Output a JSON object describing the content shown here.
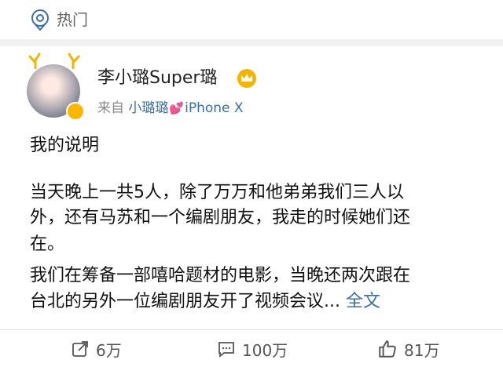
{
  "topbar": {
    "label": "热门"
  },
  "author": {
    "name": "李小璐Super璐",
    "source_prefix": "来自",
    "source_name": "小璐璐",
    "source_heart": "💕",
    "source_device": "iPhone X"
  },
  "post": {
    "line1": "我的说明",
    "line2": "当天晚上一共5人，除了万万和他弟弟我们三人以",
    "line3": "外，还有马苏和一个编剧朋友，我走的时候她们还",
    "line4": "在。",
    "line5": "我们在筹备一部嘻哈题材的电影，当晚还两次跟在",
    "line6": "台北的另外一位编剧朋友开了视频会议...",
    "more_label": "全文"
  },
  "actions": {
    "repost_count": "6万",
    "comment_count": "100万",
    "like_count": "81万"
  },
  "colors": {
    "link": "#3a6ea5",
    "badge": "#ffb600",
    "heart": "#e0264a"
  }
}
